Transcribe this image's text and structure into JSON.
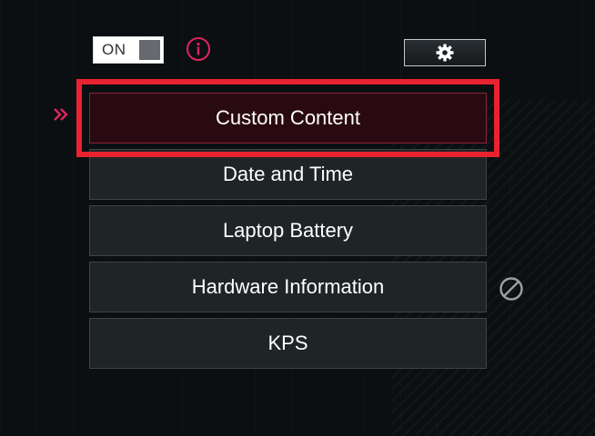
{
  "toggle": {
    "label": "ON",
    "state": "on"
  },
  "icons": {
    "info": "info-icon",
    "settings": "gear-icon",
    "selected_indicator": "double-chevron-right-icon",
    "disabled": "block-icon"
  },
  "colors": {
    "accent": "#e8232f",
    "info_pink": "#e0245e",
    "item_bg": "#1f2427",
    "active_item_bg": "#2a0a12",
    "background": "#0b0f12"
  },
  "menu": {
    "items": [
      {
        "label": "Custom Content",
        "selected": true
      },
      {
        "label": "Date and Time",
        "selected": false
      },
      {
        "label": "Laptop Battery",
        "selected": false
      },
      {
        "label": "Hardware Information",
        "selected": false,
        "disabled_indicator": true
      },
      {
        "label": "KPS",
        "selected": false
      }
    ]
  }
}
